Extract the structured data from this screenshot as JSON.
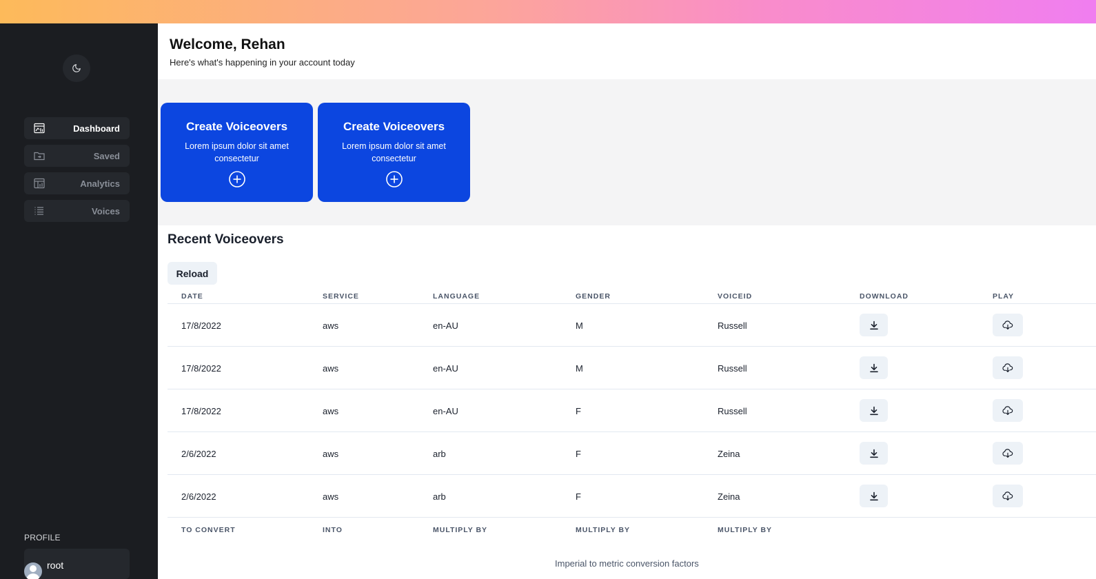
{
  "sidebar": {
    "theme_toggle_icon": "moon-icon",
    "nav": [
      {
        "label": "Dashboard",
        "icon": "dashboard-icon",
        "active": true
      },
      {
        "label": "Saved",
        "icon": "folder-icon",
        "active": false
      },
      {
        "label": "Analytics",
        "icon": "analytics-icon",
        "active": false
      },
      {
        "label": "Voices",
        "icon": "list-icon",
        "active": false
      }
    ],
    "profile_label": "PROFILE",
    "profile_name": "root"
  },
  "header": {
    "title": "Welcome, Rehan",
    "subtitle": "Here's what's happening in your account today"
  },
  "cards": [
    {
      "title": "Create Voiceovers",
      "desc": "Lorem ipsum dolor sit amet consectetur",
      "icon": "plus-circle-icon"
    },
    {
      "title": "Create Voiceovers",
      "desc": "Lorem ipsum dolor sit amet consectetur",
      "icon": "plus-circle-icon"
    }
  ],
  "recent": {
    "title": "Recent Voiceovers",
    "reload_label": "Reload",
    "columns": [
      "DATE",
      "SERVICE",
      "LANGUAGE",
      "GENDER",
      "VOICEID",
      "DOWNLOAD",
      "PLAY"
    ],
    "rows": [
      {
        "date": "17/8/2022",
        "service": "aws",
        "language": "en-AU",
        "gender": "M",
        "voiceid": "Russell"
      },
      {
        "date": "17/8/2022",
        "service": "aws",
        "language": "en-AU",
        "gender": "M",
        "voiceid": "Russell"
      },
      {
        "date": "17/8/2022",
        "service": "aws",
        "language": "en-AU",
        "gender": "F",
        "voiceid": "Russell"
      },
      {
        "date": "2/6/2022",
        "service": "aws",
        "language": "arb",
        "gender": "F",
        "voiceid": "Zeina"
      },
      {
        "date": "2/6/2022",
        "service": "aws",
        "language": "arb",
        "gender": "F",
        "voiceid": "Zeina"
      }
    ],
    "footer": [
      "TO CONVERT",
      "INTO",
      "MULTIPLY BY",
      "MULTIPLY BY",
      "MULTIPLY BY"
    ],
    "caption": "Imperial to metric conversion factors"
  },
  "colors": {
    "accent": "#0c46e0",
    "sidebar_bg": "#1b1d21"
  }
}
